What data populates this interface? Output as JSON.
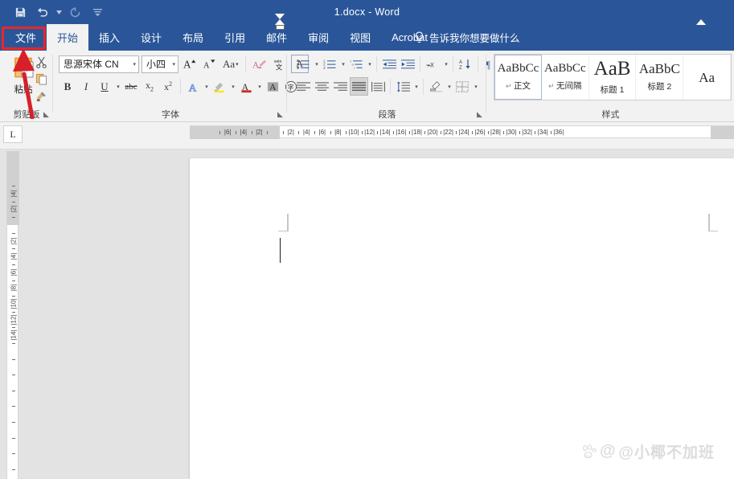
{
  "window": {
    "title": "1.docx  -  Word",
    "quick_access": [
      {
        "name": "save-icon",
        "label": "保存"
      },
      {
        "name": "undo-icon",
        "label": "撤消"
      },
      {
        "name": "redo-icon",
        "label": "恢复"
      },
      {
        "name": "customize-qat-icon",
        "label": "自定义快速访问工具栏"
      }
    ]
  },
  "ribbon": {
    "tabs": [
      {
        "label": "文件",
        "active": false,
        "file": true
      },
      {
        "label": "开始",
        "active": true,
        "file": false
      },
      {
        "label": "插入",
        "active": false,
        "file": false
      },
      {
        "label": "设计",
        "active": false,
        "file": false
      },
      {
        "label": "布局",
        "active": false,
        "file": false
      },
      {
        "label": "引用",
        "active": false,
        "file": false
      },
      {
        "label": "邮件",
        "active": false,
        "file": false
      },
      {
        "label": "审阅",
        "active": false,
        "file": false
      },
      {
        "label": "视图",
        "active": false,
        "file": false
      },
      {
        "label": "Acrobat",
        "active": false,
        "file": false
      }
    ],
    "tell_me": "告诉我你想要做什么",
    "groups": {
      "clipboard": {
        "label": "剪贴板",
        "paste_label": "粘贴",
        "buttons": [
          "剪切",
          "复制",
          "格式刷"
        ]
      },
      "font": {
        "label": "字体",
        "font_name": "思源宋体 CN",
        "font_size": "小四",
        "buttons": [
          "增大字号",
          "减小字号",
          "更改大小写",
          "清除所有格式",
          "拼音指南",
          "字符边框",
          "加粗",
          "倾斜",
          "下划线",
          "删除线",
          "下标",
          "上标",
          "文本效果和版式",
          "以不同颜色突出显示文本",
          "字体颜色",
          "字符底纹",
          "带圈字符"
        ]
      },
      "paragraph": {
        "label": "段落",
        "buttons": [
          "项目符号",
          "编号",
          "多级列表",
          "减少缩进量",
          "增加缩进量",
          "中文版式",
          "排序",
          "显示/隐藏编辑标记",
          "左对齐",
          "居中",
          "右对齐",
          "两端对齐",
          "分散对齐",
          "行和段落间距",
          "底纹",
          "边框"
        ]
      },
      "styles": {
        "label": "样式",
        "items": [
          {
            "preview": "AaBbCc",
            "name": "正文",
            "pilcrow": true,
            "selected": true,
            "size": 15
          },
          {
            "preview": "AaBbCc",
            "name": "无间隔",
            "pilcrow": true,
            "selected": false,
            "size": 15
          },
          {
            "preview": "AaB",
            "name": "标题 1",
            "pilcrow": false,
            "selected": false,
            "size": 25
          },
          {
            "preview": "AaBbC",
            "name": "标题 2",
            "pilcrow": false,
            "selected": false,
            "size": 17
          },
          {
            "preview": "Aa",
            "name": "",
            "pilcrow": false,
            "selected": false,
            "size": 17
          }
        ]
      }
    }
  },
  "ruler": {
    "tab_stop_selector": "L",
    "horizontal_labels": [
      "6",
      "4",
      "2",
      "2",
      "4",
      "6",
      "8",
      "10",
      "12",
      "14",
      "16",
      "18",
      "20",
      "22",
      "24",
      "26",
      "28",
      "30",
      "32",
      "34",
      "36"
    ],
    "vertical_labels": [
      "4",
      "2",
      "2",
      "4",
      "6",
      "8",
      "10",
      "12",
      "14"
    ],
    "left_indent_position": "0",
    "right_indent_position": "34"
  },
  "document": {
    "page_blank": true,
    "cursor_visible": true
  },
  "watermark": {
    "handle": "@小椰不加班",
    "logo": "baidu-paw-icon"
  },
  "annotation": {
    "highlight_target": "文件",
    "box_color": "#e8262a",
    "arrow_color": "#d7202a"
  },
  "colors": {
    "titlebar": "#2a5699",
    "ribbon_bg": "#f2f2f2",
    "doc_bg": "#e3e3e3",
    "accent_red": "#e8262a"
  }
}
